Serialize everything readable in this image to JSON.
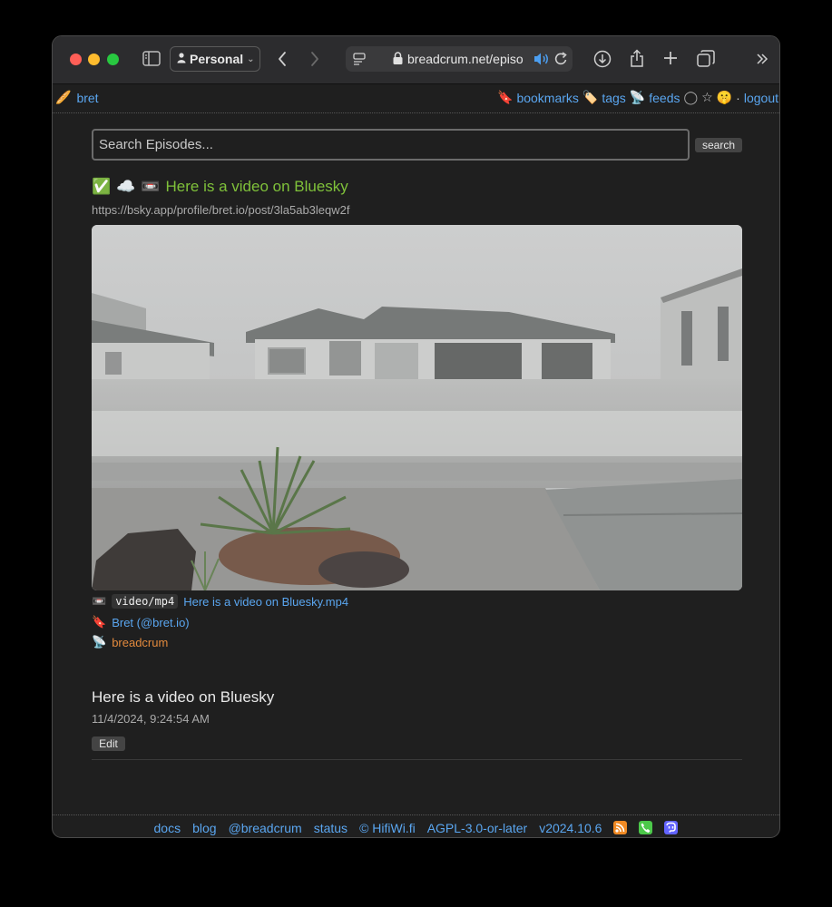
{
  "browser": {
    "profile_label": "Personal",
    "address_text": "breadcrum.net/episo"
  },
  "nav": {
    "user": "bret",
    "bookmarks": "bookmarks",
    "tags": "tags",
    "feeds": "feeds",
    "separator": "·",
    "logout": "logout"
  },
  "search": {
    "placeholder": "Search Episodes...",
    "button_label": "search"
  },
  "episode": {
    "title": "Here is a video on Bluesky",
    "source_url": "https://bsky.app/profile/bret.io/post/3la5ab3leqw2f",
    "mime_type": "video/mp4",
    "file_name": "Here is a video on Bluesky.mp4",
    "author": "Bret (@bret.io)",
    "feed": "breadcrum",
    "headline": "Here is a video on Bluesky",
    "date": "11/4/2024, 9:24:54 AM",
    "edit_label": "Edit"
  },
  "footer": {
    "links": [
      "docs",
      "blog",
      "@breadcrum",
      "status"
    ],
    "copyright": "© HifiWi.fi",
    "license": "AGPL-3.0-or-later",
    "version": "v2024.10.6"
  },
  "colors": {
    "accent_link": "#5aa6f0",
    "episode_title": "#7fc13a",
    "feed_link": "#e38a3d",
    "rss": "#f08a24",
    "phone": "#4cc84a",
    "mastodon": "#6364ff"
  }
}
